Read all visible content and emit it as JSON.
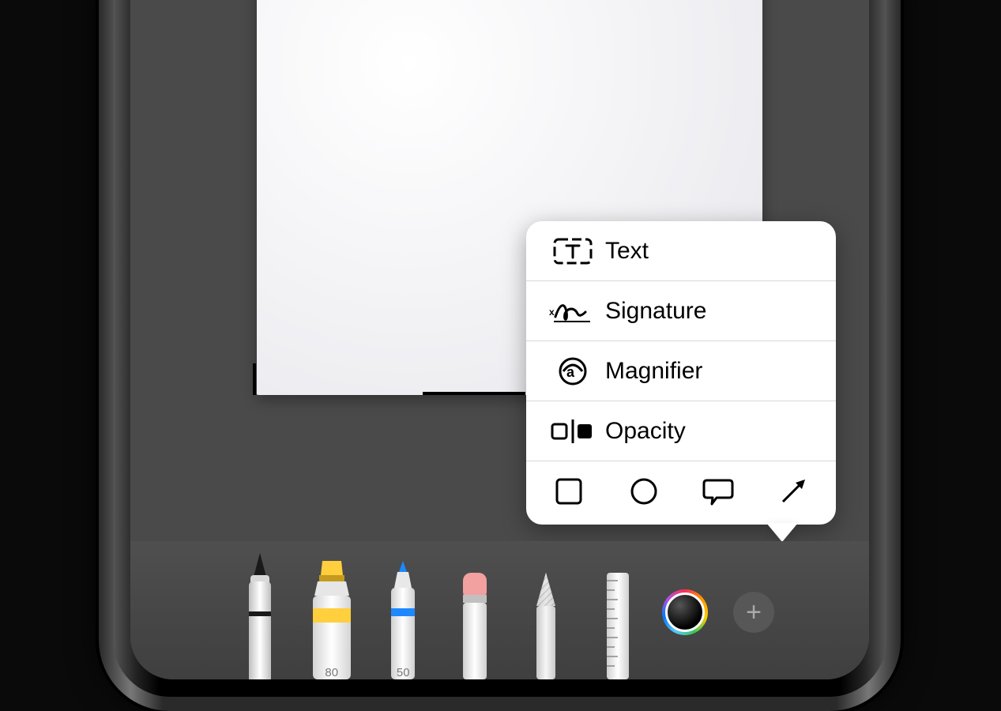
{
  "popover": {
    "items": [
      {
        "label": "Text"
      },
      {
        "label": "Signature"
      },
      {
        "label": "Magnifier"
      },
      {
        "label": "Opacity"
      }
    ]
  },
  "toolbar": {
    "tools": {
      "marker_badge": "80",
      "pencil_badge": "50"
    }
  }
}
